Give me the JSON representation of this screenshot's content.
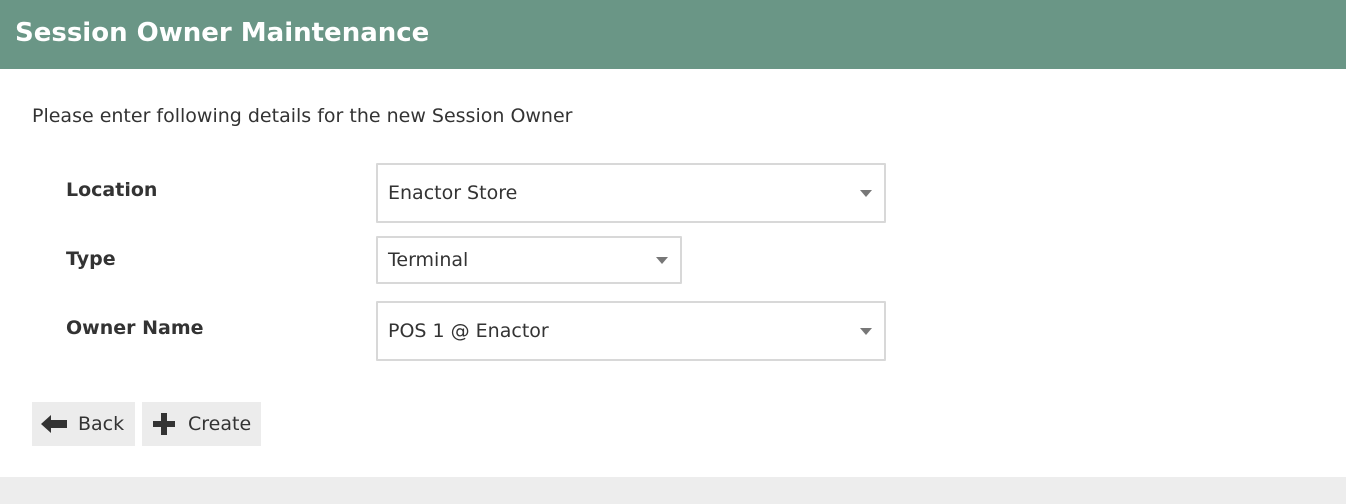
{
  "header": {
    "title": "Session Owner Maintenance"
  },
  "form": {
    "intro": "Please enter following details for the new Session Owner",
    "location": {
      "label": "Location",
      "value": "Enactor Store"
    },
    "type": {
      "label": "Type",
      "value": "Terminal"
    },
    "owner_name": {
      "label": "Owner Name",
      "value": "POS 1 @ Enactor"
    }
  },
  "actions": {
    "back": {
      "label": "Back",
      "icon": "arrow-left-icon"
    },
    "create": {
      "label": "Create",
      "icon": "plus-icon"
    }
  },
  "colors": {
    "header_bg": "#6a9686",
    "button_bg": "#ececec",
    "footer_bg": "#ededed"
  }
}
